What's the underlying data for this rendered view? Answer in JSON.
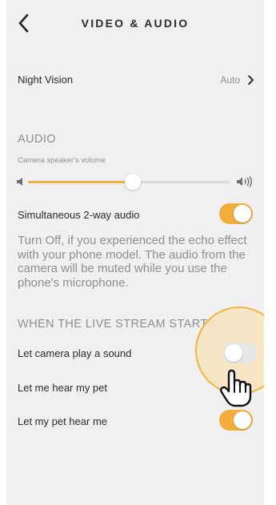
{
  "header": {
    "title": "VIDEO & AUDIO",
    "back_icon": "chevron-left-icon"
  },
  "night_vision": {
    "label": "Night Vision",
    "value": "Auto",
    "chevron_icon": "chevron-right-icon"
  },
  "audio": {
    "section_title": "AUDIO",
    "volume_label": "Camera speaker's volume",
    "volume_fraction": 0.52,
    "low_icon": "speaker-low-icon",
    "high_icon": "speaker-high-icon",
    "two_way": {
      "label": "Simultaneous 2-way audio",
      "on": true
    },
    "note": "Turn Off, if you experienced the echo effect with your phone model. The audio from the camera will be muted while you use the phone's microphone."
  },
  "live_stream": {
    "section_title": "WHEN THE LIVE STREAM STARTS",
    "items": [
      {
        "label": "Let camera play a sound",
        "on": false
      },
      {
        "label": "Let me hear my pet",
        "on": false
      },
      {
        "label": "Let my pet hear me",
        "on": true
      }
    ]
  },
  "colors": {
    "accent": "#f2ad3c",
    "background": "#f0f0f2",
    "muted": "#8e8e8e"
  },
  "overlay": {
    "icon": "hand-pointer-icon"
  }
}
